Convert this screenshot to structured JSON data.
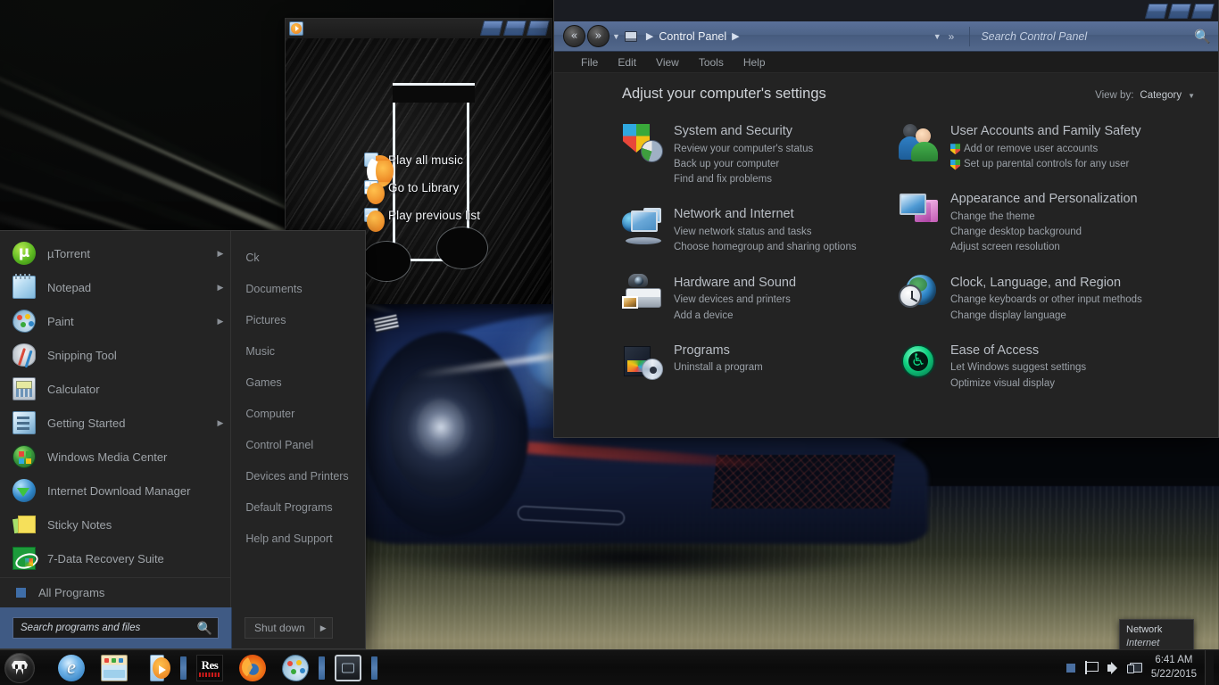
{
  "desktop": {
    "wallpaper_description": "blue sports car with headlight flare on a motion-blurred tunnel road"
  },
  "media_player": {
    "app_icon": "media-player-icon",
    "window_buttons": [
      "minimize",
      "maximize",
      "close"
    ],
    "jumplist": [
      {
        "icon": "play-icon",
        "label": "Play all music"
      },
      {
        "icon": "library-icon",
        "label": "Go to Library"
      },
      {
        "icon": "back-arrow-icon",
        "label": "Play previous list"
      }
    ]
  },
  "control_panel": {
    "window_buttons": [
      "minimize",
      "maximize",
      "close"
    ],
    "address": {
      "back_icon": "back-chevrons-icon",
      "forward_icon": "forward-chevrons-icon",
      "computer_icon": "computer-icon",
      "breadcrumb": "Control Panel",
      "separator": "▶",
      "history_icon": "history-dropdown-icon",
      "recent_icon": "recent-pages-icon",
      "search_placeholder": "Search Control Panel",
      "search_value": "",
      "search_icon": "search-icon"
    },
    "menubar": [
      "File",
      "Edit",
      "View",
      "Tools",
      "Help"
    ],
    "title": "Adjust your computer's settings",
    "view_by": {
      "label": "View by:",
      "value": "Category",
      "caret": "▾"
    },
    "categories_left": [
      {
        "icon": "system-and-security-icon",
        "title": "System and Security",
        "links": [
          {
            "text": "Review your computer's status",
            "shield": false
          },
          {
            "text": "Back up your computer",
            "shield": false
          },
          {
            "text": "Find and fix problems",
            "shield": false
          }
        ]
      },
      {
        "icon": "network-and-internet-icon",
        "title": "Network and Internet",
        "links": [
          {
            "text": "View network status and tasks",
            "shield": false
          },
          {
            "text": "Choose homegroup and sharing options",
            "shield": false
          }
        ]
      },
      {
        "icon": "hardware-and-sound-icon",
        "title": "Hardware and Sound",
        "links": [
          {
            "text": "View devices and printers",
            "shield": false
          },
          {
            "text": "Add a device",
            "shield": false
          }
        ]
      },
      {
        "icon": "programs-icon",
        "title": "Programs",
        "links": [
          {
            "text": "Uninstall a program",
            "shield": false
          }
        ]
      }
    ],
    "categories_right": [
      {
        "icon": "user-accounts-icon",
        "title": "User Accounts and Family Safety",
        "links": [
          {
            "text": "Add or remove user accounts",
            "shield": true
          },
          {
            "text": "Set up parental controls for any user",
            "shield": true
          }
        ]
      },
      {
        "icon": "appearance-icon",
        "title": "Appearance and Personalization",
        "links": [
          {
            "text": "Change the theme",
            "shield": false
          },
          {
            "text": "Change desktop background",
            "shield": false
          },
          {
            "text": "Adjust screen resolution",
            "shield": false
          }
        ]
      },
      {
        "icon": "clock-language-region-icon",
        "title": "Clock, Language, and Region",
        "links": [
          {
            "text": "Change keyboards or other input methods",
            "shield": false
          },
          {
            "text": "Change display language",
            "shield": false
          }
        ]
      },
      {
        "icon": "ease-of-access-icon",
        "title": "Ease of Access",
        "links": [
          {
            "text": "Let Windows suggest settings",
            "shield": false
          },
          {
            "text": "Optimize visual display",
            "shield": false
          }
        ]
      }
    ]
  },
  "start_menu": {
    "programs": [
      {
        "icon": "utorrent-icon",
        "label": "µTorrent",
        "has_arrow": true
      },
      {
        "icon": "notepad-icon",
        "label": "Notepad",
        "has_arrow": true
      },
      {
        "icon": "paint-icon",
        "label": "Paint",
        "has_arrow": true
      },
      {
        "icon": "snipping-tool-icon",
        "label": "Snipping Tool",
        "has_arrow": false
      },
      {
        "icon": "calculator-icon",
        "label": "Calculator",
        "has_arrow": false
      },
      {
        "icon": "getting-started-icon",
        "label": "Getting Started",
        "has_arrow": true
      },
      {
        "icon": "windows-media-center-icon",
        "label": "Windows Media Center",
        "has_arrow": false
      },
      {
        "icon": "internet-download-manager-icon",
        "label": "Internet Download Manager",
        "has_arrow": false
      },
      {
        "icon": "sticky-notes-icon",
        "label": "Sticky Notes",
        "has_arrow": false
      },
      {
        "icon": "seven-data-recovery-icon",
        "label": "7-Data Recovery Suite",
        "has_arrow": false
      }
    ],
    "all_programs": "All Programs",
    "places": [
      "Ck",
      "Documents",
      "Pictures",
      "Music",
      "Games",
      "Computer",
      "Control Panel",
      "Devices and Printers",
      "Default Programs",
      "Help and Support"
    ],
    "search": {
      "placeholder": "Search programs and files",
      "value": "",
      "icon": "search-icon"
    },
    "shutdown": {
      "label": "Shut down",
      "arrow": "▶"
    }
  },
  "taskbar": {
    "start_orb": "punisher-skull-start-orb",
    "buttons": [
      {
        "icon": "internet-explorer-icon",
        "name": "internet-explorer"
      },
      {
        "icon": "windows-explorer-icon",
        "name": "windows-explorer"
      },
      {
        "icon": "windows-media-player-icon",
        "name": "windows-media-player"
      },
      {
        "icon": "res-icon",
        "name": "res-app",
        "text": "Res"
      },
      {
        "icon": "firefox-icon",
        "name": "firefox"
      },
      {
        "icon": "paint-icon",
        "name": "paint"
      },
      {
        "icon": "remote-display-icon",
        "name": "remote-display"
      }
    ],
    "tray": {
      "icons": [
        {
          "icon": "show-hidden-icons-icon"
        },
        {
          "icon": "action-center-flag-icon"
        },
        {
          "icon": "volume-speaker-icon"
        },
        {
          "icon": "network-icon"
        }
      ],
      "clock_time": "6:41 AM",
      "clock_date": "5/22/2015"
    },
    "tooltip": {
      "title": "Network",
      "subtitle": "Internet access"
    }
  }
}
